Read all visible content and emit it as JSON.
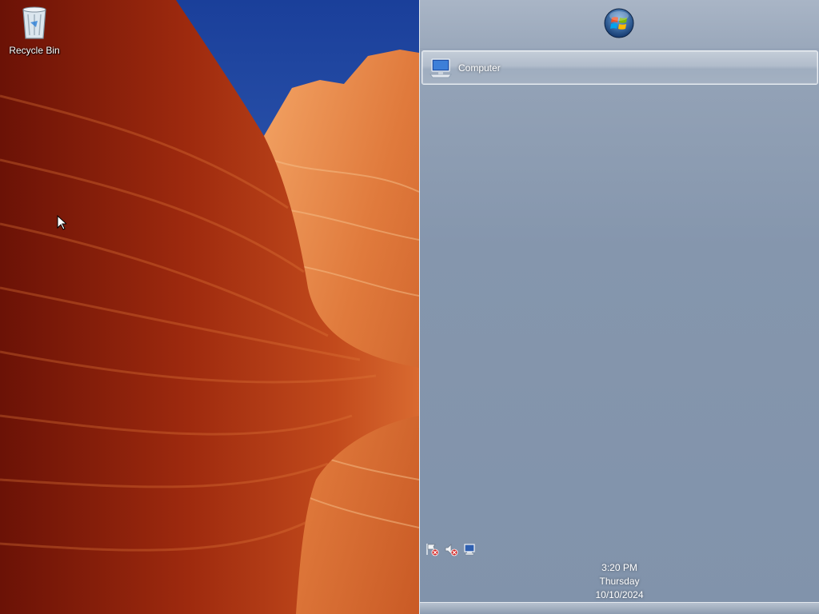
{
  "desktop": {
    "icons": [
      {
        "label": "Recycle Bin",
        "icon": "recycle-bin-icon"
      }
    ]
  },
  "taskbar": {
    "start_button_icon": "windows-orb-icon",
    "buttons": [
      {
        "label": "Computer",
        "icon": "computer-icon"
      }
    ],
    "tray_icons": [
      "action-center-flag-icon",
      "volume-muted-icon",
      "network-icon"
    ],
    "clock": {
      "time": "3:20 PM",
      "day": "Thursday",
      "date": "10/10/2024"
    }
  },
  "colors": {
    "taskbar": "#8193ab",
    "wallpaper_rock": "#c0401a",
    "sky": "#1f4fb0"
  }
}
